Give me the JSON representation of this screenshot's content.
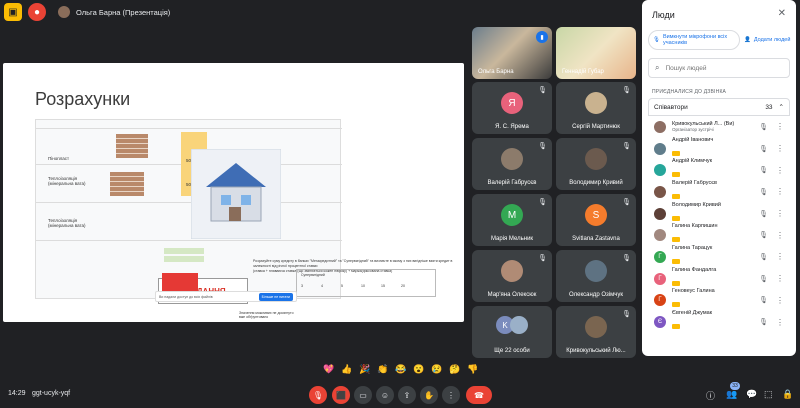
{
  "topbar": {
    "presenter_label": "Ольга Барна (Презентація)"
  },
  "slide": {
    "title": "Розрахунки",
    "rows": [
      "Пінопласт",
      "Теплоізоляція (мінеральна вата)",
      "Теплоізоляція (мінеральна вата)"
    ],
    "values": [
      "50",
      "5400",
      "50",
      "37800"
    ],
    "task_title": "ЗАВДАННЯ",
    "task_text": "Розрахуйте суму кредиту в банках \"Мегакредитний\" та \"Супервигідний\" та визначте в якому з них вигідніше взяти кредит в залежності від річної процентної ставки",
    "formula_text": "(ставка + плаваюча ставка (що змінюється кожен півроку) + маржа(фіксована ставка)",
    "note": "Значення можливих не досягнуто вже обґрунтовано",
    "access_bar_text": "Ви надали доступ до всіх файлів",
    "access_bar_button": "Більше не питати",
    "mini_table_header": "Супервигідний",
    "mini_table_values": [
      "3",
      "4",
      "5",
      "10",
      "15",
      "20"
    ]
  },
  "tiles": [
    {
      "name": "Ольга Барна",
      "type": "video"
    },
    {
      "name": "Геннадій Губар",
      "type": "video"
    },
    {
      "name": "Я. С. Ярема",
      "initial": "Я",
      "color": "#e8627b"
    },
    {
      "name": "Сергій Мартинюк",
      "initial": "",
      "color": "#3c4043"
    },
    {
      "name": "Валерій Габрусєв",
      "initial": "",
      "color": "#3c4043"
    },
    {
      "name": "Володимир Кривий",
      "initial": "",
      "color": "#3c4043"
    },
    {
      "name": "Марія Мельник",
      "initial": "M",
      "color": "#33a853"
    },
    {
      "name": "Svitlana Zastavna",
      "initial": "S",
      "color": "#f57c2c"
    },
    {
      "name": "Мар'яна Олексюк",
      "initial": "",
      "color": "#3c4043"
    },
    {
      "name": "Олександр Озімчук",
      "initial": "",
      "color": "#3c4043"
    },
    {
      "name": "Ще 22 особи",
      "initial": "K",
      "color": "#7b8cbd"
    },
    {
      "name": "Кривокульський Лю...",
      "initial": "",
      "color": "#3c4043"
    }
  ],
  "panel": {
    "title": "Люди",
    "mute_all_label": "Вимкнути мікрофони всіх учасників",
    "add_people_label": "Додати людей",
    "search_placeholder": "Пошук людей",
    "section_label": "ПРИЄДНАЛИСЯ ДО ДЗВІНКА",
    "group_label": "Співавтори",
    "group_count": "33",
    "participants": [
      {
        "name": "Кривокульський Л... (Ви)",
        "sub": "Організатор зустрічі",
        "color": "#8d6e63",
        "initial": ""
      },
      {
        "name": "Андрій Іванович",
        "sub": "",
        "color": "#607d8b",
        "initial": ""
      },
      {
        "name": "Андрій Климчук",
        "sub": "",
        "color": "#26a69a",
        "initial": ""
      },
      {
        "name": "Валерій Габрусєв",
        "sub": "",
        "color": "#795548",
        "initial": ""
      },
      {
        "name": "Володимир Кривий",
        "sub": "",
        "color": "#5d4037",
        "initial": ""
      },
      {
        "name": "Галина Карпишин",
        "sub": "",
        "color": "#a1887f",
        "initial": ""
      },
      {
        "name": "Галина Тарацук",
        "sub": "",
        "color": "#34a853",
        "initial": "Г"
      },
      {
        "name": "Галина Фандалга",
        "sub": "",
        "color": "#e8627b",
        "initial": "Г"
      },
      {
        "name": "Геновеус Галина",
        "sub": "",
        "color": "#d84315",
        "initial": "Г"
      },
      {
        "name": "Євгеній Джумак",
        "sub": "",
        "color": "#7e57c2",
        "initial": "Є"
      }
    ]
  },
  "reactions": [
    "💖",
    "👍",
    "🎉",
    "👏",
    "😂",
    "😮",
    "😢",
    "🤔",
    "👎"
  ],
  "bottombar": {
    "time": "14:29",
    "meeting_code": "ggt-ucyk-yqf",
    "people_count": "33"
  }
}
